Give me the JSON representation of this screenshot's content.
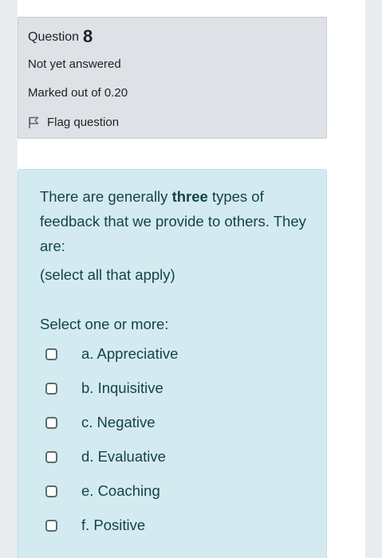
{
  "info": {
    "question_label": "Question",
    "question_number": "8",
    "state": "Not yet answered",
    "grade": "Marked out of 0.20",
    "flag_label": "Flag question",
    "flag_icon": "flag-icon"
  },
  "question": {
    "text_before": "There are generally ",
    "text_bold": "three",
    "text_after": " types of feedback that we provide to others. They are:",
    "hint": "(select all that apply)",
    "prompt": "Select one or more:",
    "options": [
      {
        "label": "a. Appreciative",
        "checked": false
      },
      {
        "label": "b. Inquisitive",
        "checked": false
      },
      {
        "label": "c. Negative",
        "checked": false
      },
      {
        "label": "d. Evaluative",
        "checked": false
      },
      {
        "label": "e. Coaching",
        "checked": false
      },
      {
        "label": "f. Positive",
        "checked": false
      }
    ]
  },
  "colors": {
    "info_background": "#dee2e6",
    "question_background": "#d3ebf0",
    "question_text": "#15424c"
  }
}
